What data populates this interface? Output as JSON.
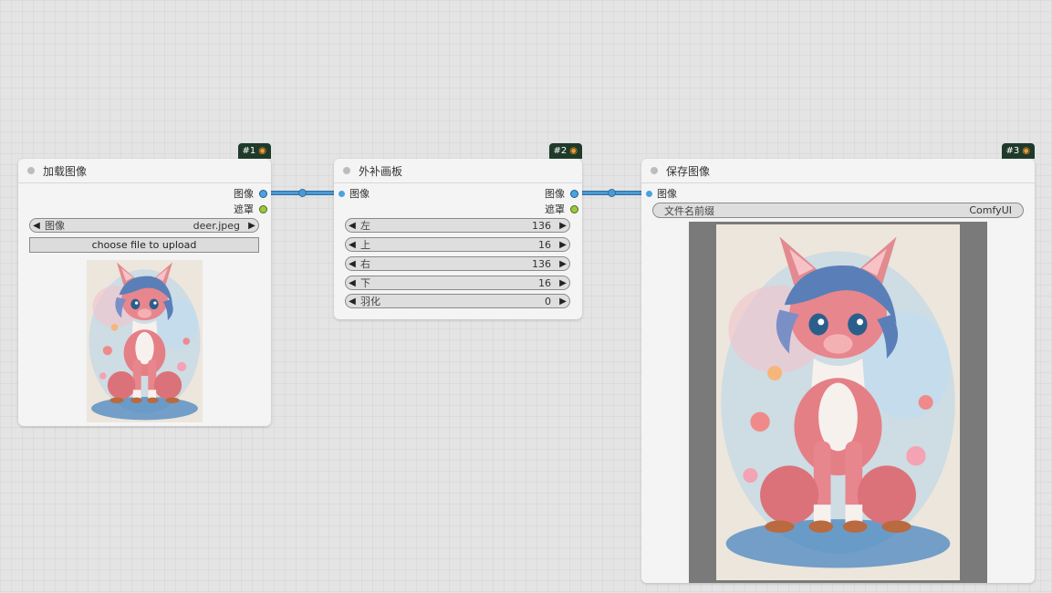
{
  "nodes": {
    "load": {
      "badge": "#1",
      "title": "加载图像",
      "outputs": [
        "图像",
        "遮罩"
      ],
      "image_widget": {
        "label": "图像",
        "value": "deer.jpeg"
      },
      "upload_label": "choose file to upload"
    },
    "pad": {
      "badge": "#2",
      "title": "外补画板",
      "input": "图像",
      "outputs": [
        "图像",
        "遮罩"
      ],
      "widgets": [
        {
          "label": "左",
          "value": "136"
        },
        {
          "label": "上",
          "value": "16"
        },
        {
          "label": "右",
          "value": "136"
        },
        {
          "label": "下",
          "value": "16"
        },
        {
          "label": "羽化",
          "value": "0"
        }
      ]
    },
    "save": {
      "badge": "#3",
      "title": "保存图像",
      "input": "图像",
      "prefix_widget": {
        "label": "文件名前缀",
        "value": "ComfyUI"
      }
    }
  },
  "colors": {
    "image_slot": "#4aa3df",
    "mask_slot": "#9bc93f",
    "wire": "#4a9ad6",
    "badge_bg": "#1f3a2a"
  },
  "icons": {
    "badge": "fox-icon",
    "arrow_left": "triangle-left-icon",
    "arrow_right": "triangle-right-icon"
  }
}
